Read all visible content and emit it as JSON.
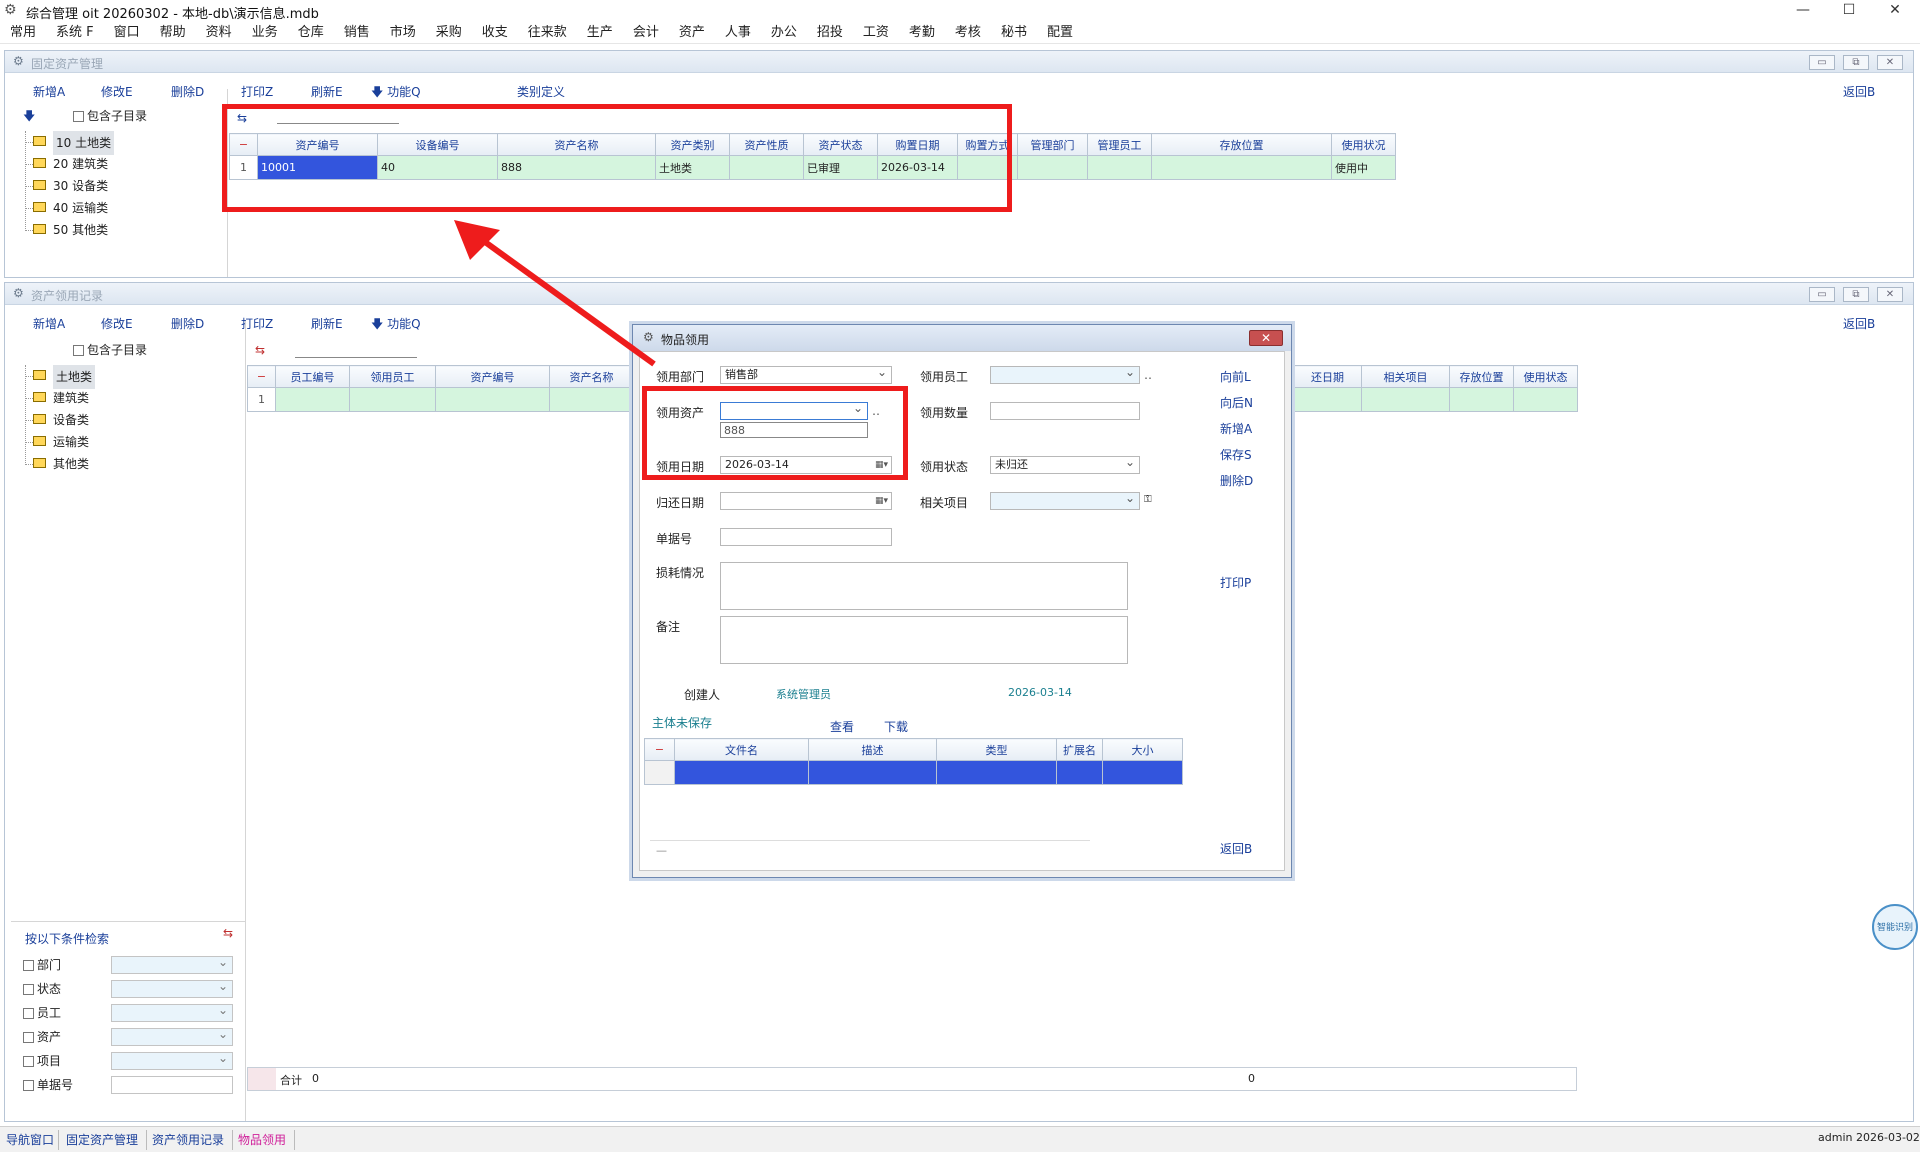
{
  "window": {
    "title": "综合管理 oit 20260302 - 本地-db\\演示信息.mdb",
    "controls": [
      "—",
      "☐",
      "✕"
    ]
  },
  "menu": [
    "常用",
    "系统 F",
    "窗口",
    "帮助",
    "资料",
    "业务",
    "仓库",
    "销售",
    "市场",
    "采购",
    "收支",
    "往来款",
    "生产",
    "会计",
    "资产",
    "人事",
    "办公",
    "招投",
    "工资",
    "考勤",
    "考核",
    "秘书",
    "配置"
  ],
  "fixed_assets": {
    "title": "固定资产管理",
    "toolbar": {
      "add": "新增A",
      "edit": "修改E",
      "delete": "删除D",
      "print": "打印Z",
      "refresh": "刷新E",
      "function": "功能Q",
      "category_def": "类别定义",
      "back": "返回B"
    },
    "include_sub": "包含子目录",
    "tree": [
      "10 土地类",
      "20 建筑类",
      "30 设备类",
      "40 运输类",
      "50 其他类"
    ],
    "columns": [
      "资产编号",
      "设备编号",
      "资产名称",
      "资产类别",
      "资产性质",
      "资产状态",
      "购置日期",
      "购置方式",
      "管理部门",
      "管理员工",
      "存放位置",
      "使用状况"
    ],
    "rows": [
      {
        "no": "1",
        "cells": [
          "10001",
          "40",
          "888",
          "土地类",
          "",
          "已审理",
          "2026-03-14",
          "",
          "",
          "",
          "",
          "使用中"
        ]
      }
    ]
  },
  "usage_records": {
    "title": "资产领用记录",
    "toolbar": {
      "add": "新增A",
      "edit": "修改E",
      "delete": "删除D",
      "print": "打印Z",
      "refresh": "刷新E",
      "function": "功能Q",
      "back": "返回B"
    },
    "include_sub": "包含子目录",
    "tree": [
      "土地类",
      "建筑类",
      "设备类",
      "运输类",
      "其他类"
    ],
    "columns_left": [
      "员工编号",
      "领用员工",
      "资产编号",
      "资产名称"
    ],
    "columns_right": [
      "还日期",
      "相关项目",
      "存放位置",
      "使用状态"
    ],
    "row_no": "1",
    "total_label": "合计",
    "total_value": "0",
    "total_right": "0",
    "search": {
      "title": "按以下条件检索",
      "fields": [
        "部门",
        "状态",
        "员工",
        "资产",
        "项目",
        "单据号"
      ]
    }
  },
  "dialog": {
    "title": "物品领用",
    "close": "✕",
    "labels": {
      "dept": "领用部门",
      "employee": "领用员工",
      "asset": "领用资产",
      "qty": "领用数量",
      "date": "领用日期",
      "status": "领用状态",
      "return_date": "归还日期",
      "project": "相关项目",
      "doc_no": "单据号",
      "wear": "损耗情况",
      "remark": "备注"
    },
    "values": {
      "dept": "销售部",
      "asset_option": "888",
      "date": "2026-03-14",
      "status": "未归还"
    },
    "buttons": {
      "prev": "向前L",
      "next": "向后N",
      "add": "新增A",
      "save": "保存S",
      "delete": "删除D",
      "print": "打印P",
      "back": "返回B"
    },
    "creator_label": "创建人",
    "creator": "系统管理员",
    "created_date": "2026-03-14",
    "unsaved": "主体未保存",
    "view": "查看",
    "download": "下载",
    "attach_columns": [
      "文件名",
      "描述",
      "类型",
      "扩展名",
      "大小"
    ]
  },
  "statusbar": {
    "tabs": [
      "导航窗口",
      "固定资产管理",
      "资产领用记录",
      "物品领用"
    ],
    "user": "admin",
    "date": "2026-03-02"
  },
  "float_badge": "智能识别"
}
